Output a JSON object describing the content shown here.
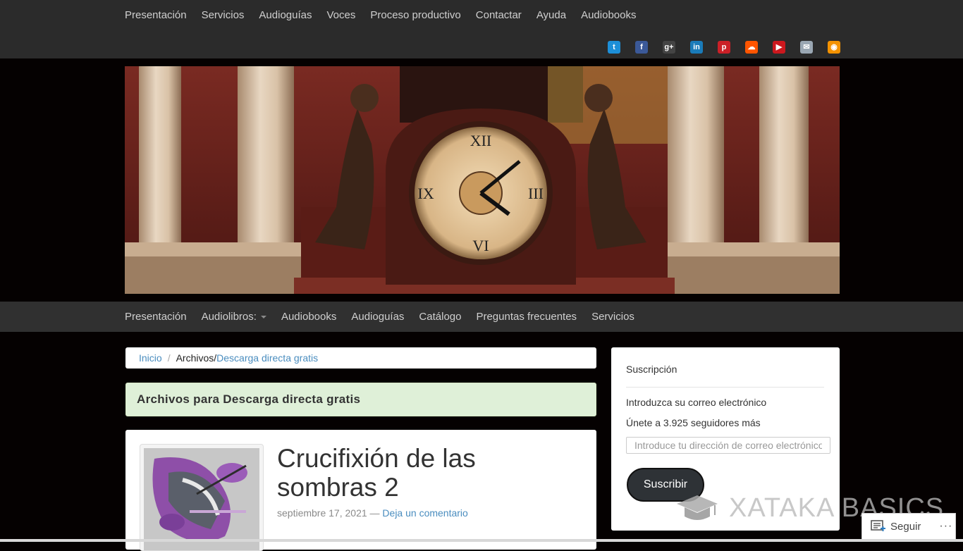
{
  "top_nav": [
    "Presentación",
    "Servicios",
    "Audioguías",
    "Voces",
    "Proceso productivo",
    "Contactar",
    "Ayuda",
    "Audiobooks"
  ],
  "social": [
    {
      "icon": "twitter-icon",
      "color": "#1d8fd8",
      "glyph": "t"
    },
    {
      "icon": "facebook-icon",
      "color": "#3b5998",
      "glyph": "f"
    },
    {
      "icon": "google-plus-icon",
      "color": "#444444",
      "glyph": "g+"
    },
    {
      "icon": "linkedin-icon",
      "color": "#1a7bb9",
      "glyph": "in"
    },
    {
      "icon": "pinterest-icon",
      "color": "#cb2027",
      "glyph": "p"
    },
    {
      "icon": "soundcloud-icon",
      "color": "#ff5500",
      "glyph": "☁"
    },
    {
      "icon": "youtube-icon",
      "color": "#cc181e",
      "glyph": "▶"
    },
    {
      "icon": "email-icon",
      "color": "#9aa7b3",
      "glyph": "✉"
    },
    {
      "icon": "rss-icon",
      "color": "#f39200",
      "glyph": "◉"
    }
  ],
  "sub_nav": {
    "items": [
      "Presentación",
      "Audiolibros:",
      "Audiobooks",
      "Audioguías",
      "Catálogo",
      "Preguntas frecuentes",
      "Servicios"
    ],
    "dropdown_index": 1
  },
  "breadcrumb": {
    "home": "Inicio",
    "separator": "/",
    "archives": "Archivos/",
    "current": "Descarga directa gratis"
  },
  "archive_title": "Archivos para Descarga directa gratis",
  "post": {
    "title_line1": "Crucifixión de las",
    "title_line2": "sombras 2",
    "date": "septiembre 17, 2021",
    "dash": " — ",
    "comment_link": "Deja un comentario"
  },
  "sidebar": {
    "title": "Suscripción",
    "prompt": "Introduzca su correo electrónico",
    "followers": "Únete a 3.925 seguidores más",
    "email_placeholder": "Introduce tu dirección de correo electrónico",
    "button": "Suscribir"
  },
  "watermark": "XATAKA BASICS",
  "follow_bar": {
    "label": "Seguir",
    "more": "···"
  },
  "colors": {
    "link": "#4a8dbf",
    "top_bar": "#2b2b2b",
    "sub_nav": "#303030",
    "page_bg": "#050101",
    "alert_bg": "#dff0d8"
  }
}
